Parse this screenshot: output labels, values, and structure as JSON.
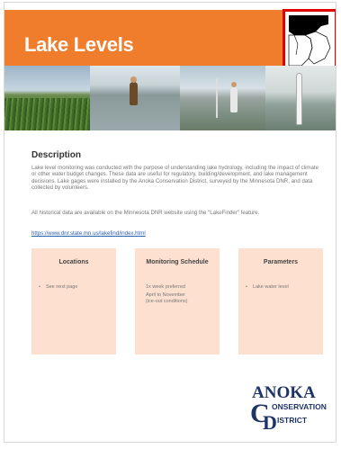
{
  "header": {
    "title": "Lake Levels"
  },
  "description": {
    "heading": "Description",
    "paragraph": "Lake level monitoring was conducted with the purpose of understanding lake hydrology, including the impact of climate or other water budget changes. These data are useful for regulatory, building/development, and lake management decisions. Lake gages were installed by the Anoka Conservation District, surveyed by the Minnesota DNR, and data collected by volunteers.",
    "note": "All historical data are available on the Minnesota DNR website using the \"LakeFinder\" feature.",
    "link": "https://www.dnr.state.mn.us/lakefind/index.html"
  },
  "cards": [
    {
      "title": "Locations",
      "items": [
        "See next page"
      ]
    },
    {
      "title": "Monitoring Schedule",
      "lines": [
        "1x week preferred",
        "April to November",
        "(ice-out conditions)"
      ]
    },
    {
      "title": "Parameters",
      "items": [
        "Lake water level"
      ]
    }
  ],
  "logo": {
    "top": "ANOKA",
    "line2": "ONSERVATION",
    "line3": "ISTRICT"
  },
  "colors": {
    "banner": "#ef7d2b",
    "card": "#fde0d0",
    "map_border": "#e00000",
    "link": "#2a5db0",
    "logo_blue": "#1f3466"
  },
  "icons": [
    "county-locator-map",
    "anoka-conservation-district-logo"
  ]
}
